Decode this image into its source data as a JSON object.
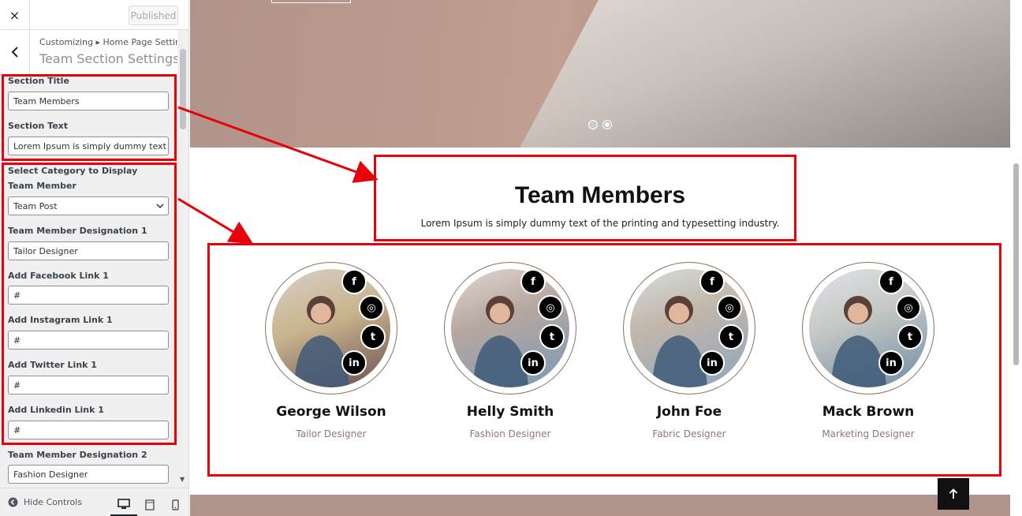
{
  "topbar": {
    "close_label": "×",
    "published_label": "Published"
  },
  "section_head": {
    "breadcrumb": "Customizing ▸ Home Page Settings",
    "title": "Team Section Settings"
  },
  "fields": {
    "section_title_label": "Section Title",
    "section_title_value": "Team Members",
    "section_text_label": "Section Text",
    "section_text_value": "Lorem Ipsum is simply dummy text of",
    "category_label": "Select Category to Display Team Member",
    "category_value": "Team Post",
    "designation1_label": "Team Member Designation 1",
    "designation1_value": "Tailor Designer",
    "facebook1_label": "Add Facebook Link 1",
    "facebook1_value": "#",
    "instagram1_label": "Add Instagram Link 1",
    "instagram1_value": "#",
    "twitter1_label": "Add Twitter Link 1",
    "twitter1_value": "#",
    "linkedin1_label": "Add Linkedin Link 1",
    "linkedin1_value": "#",
    "designation2_label": "Team Member Designation 2",
    "designation2_value": "Fashion Designer"
  },
  "footer": {
    "hide_controls": "Hide Controls"
  },
  "preview": {
    "title": "Team Members",
    "text": "Lorem Ipsum is simply dummy text of the printing and typesetting industry.",
    "members": [
      {
        "name": "George Wilson",
        "role": "Tailor Designer"
      },
      {
        "name": "Helly Smith",
        "role": "Fashion Designer"
      },
      {
        "name": "John Foe",
        "role": "Fabric Designer"
      },
      {
        "name": "Mack Brown",
        "role": "Marketing Designer"
      }
    ],
    "social_icons": [
      "facebook-icon",
      "instagram-icon",
      "twitter-icon",
      "linkedin-icon"
    ]
  },
  "colors": {
    "highlight": "#e8000b",
    "accent": "#b0938a",
    "role_text": "#8e786f"
  }
}
